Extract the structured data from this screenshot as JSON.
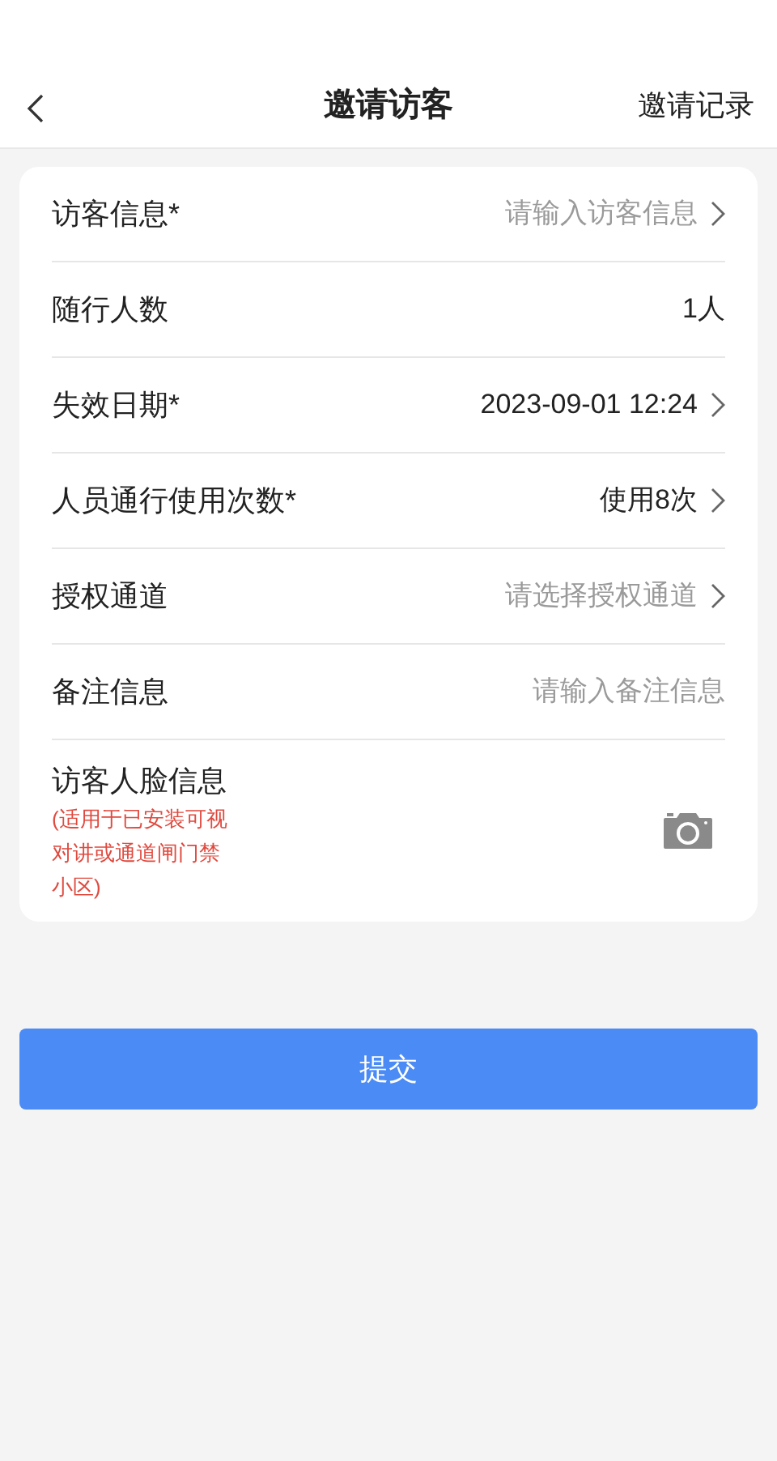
{
  "header": {
    "title": "邀请访客",
    "action": "邀请记录"
  },
  "rows": [
    {
      "kind": "field",
      "label": "访客信息*",
      "placeholder": "请输入访客信息",
      "chevron": true
    },
    {
      "kind": "value",
      "label": "随行人数",
      "value": "1人",
      "chevron": false
    },
    {
      "kind": "value",
      "label": "失效日期*",
      "value": "2023-09-01 12:24",
      "chevron": true
    },
    {
      "kind": "value",
      "label": "人员通行使用次数*",
      "value": "使用8次",
      "chevron": true
    },
    {
      "kind": "field",
      "label": "授权通道",
      "placeholder": "请选择授权通道",
      "chevron": true
    },
    {
      "kind": "field",
      "label": "备注信息",
      "placeholder": "请输入备注信息",
      "chevron": false
    },
    {
      "kind": "photo",
      "label": "访客人脸信息",
      "note": "(适用于已安装可视对讲或通道闸门禁小区)"
    }
  ],
  "submit": "提交"
}
